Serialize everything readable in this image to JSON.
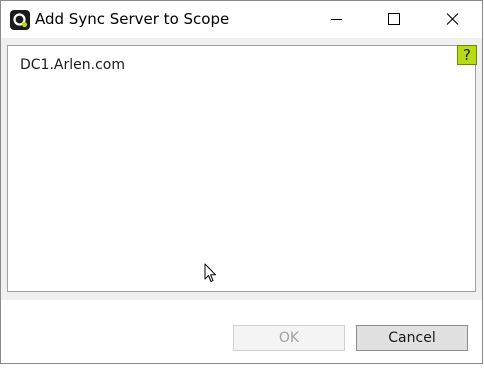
{
  "window": {
    "title": "Add Sync Server to Scope",
    "icons": {
      "app": "app-logo-icon",
      "minimize": "minimize-icon",
      "maximize": "maximize-icon",
      "close": "close-icon"
    }
  },
  "list": {
    "items": [
      {
        "label": "DC1.Arlen.com"
      }
    ]
  },
  "help": {
    "label": "?",
    "color": "#b7dc16"
  },
  "buttons": {
    "ok_label": "OK",
    "ok_enabled": false,
    "cancel_label": "Cancel"
  }
}
